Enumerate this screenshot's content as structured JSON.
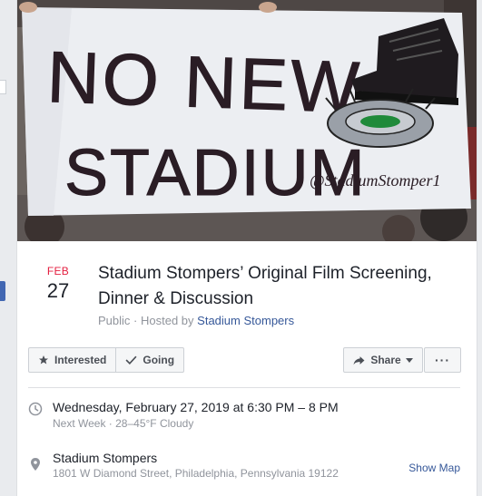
{
  "cover": {
    "banner_line1": "NO NEW",
    "banner_line2": "STADIUM",
    "banner_handle": "@StadiumStomper1"
  },
  "event": {
    "date_month": "FEB",
    "date_day": "27",
    "title": "Stadium Stompers’ Original Film Screening, Dinner & Discussion",
    "privacy": "Public",
    "hosted_by_prefix": "Hosted by",
    "host_name": "Stadium Stompers"
  },
  "actions": {
    "interested_label": "Interested",
    "going_label": "Going",
    "share_label": "Share",
    "more_label": "···"
  },
  "details": {
    "time_main": "Wednesday, February 27, 2019 at 6:30 PM – 8 PM",
    "time_sub": "Next Week · 28–45°F Cloudy",
    "location_name": "Stadium Stompers",
    "location_address": "1801 W Diamond Street, Philadelphia, Pennsylvania 19122",
    "show_map_label": "Show Map"
  },
  "colors": {
    "accent": "#4267b2",
    "link": "#365899",
    "date_red": "#e41e3f"
  }
}
